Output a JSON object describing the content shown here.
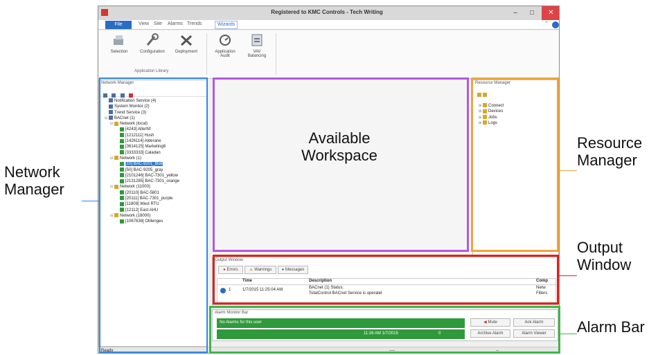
{
  "window": {
    "title": "Registered to KMC Controls - Tech Writing",
    "minimize": "–",
    "maximize": "□",
    "close": "✕"
  },
  "menu": {
    "file": "File",
    "view": "View",
    "site": "Site",
    "alarms": "Alarms",
    "trends": "Trends",
    "wizards": "Wizards",
    "up_arrow": "⌃"
  },
  "ribbon": {
    "buttons": [
      "Selection",
      "Configuration",
      "Deployment",
      "Application Audit",
      "VAV Balancing"
    ],
    "group_label": "Application Library"
  },
  "network_manager": {
    "title": "Network Manager",
    "rows": [
      {
        "text": "Notification Service (4)"
      },
      {
        "text": "System Monitor (2)"
      },
      {
        "text": "Trend Service (3)"
      },
      {
        "text": "BACnet (1)"
      },
      {
        "text": "Network (local)"
      },
      {
        "text": "[4243] AlterNf"
      },
      {
        "text": "[1212111] Hush"
      },
      {
        "text": "[1426114] Alderane"
      },
      {
        "text": "[3614125] Marketing8"
      },
      {
        "text": "[3333333] Caladan"
      },
      {
        "text": "Network (1)"
      },
      {
        "text": "[10] BAC-9201_blue"
      },
      {
        "text": "[50] BAC-9205_gray"
      },
      {
        "text": "[2101246] BAC-7301_yellow"
      },
      {
        "text": "[2131285] BAC-7301_orange"
      },
      {
        "text": "Network (11000)"
      },
      {
        "text": "[20110] BAC-5801"
      },
      {
        "text": "[20111] BAC-7301_purple"
      },
      {
        "text": "[11809] West RTU"
      },
      {
        "text": "[12112] East AHU"
      },
      {
        "text": "Network (18000)"
      },
      {
        "text": "[1067638] OMenges"
      }
    ],
    "status": "Ready"
  },
  "resource_manager": {
    "title": "Resource Manager",
    "items": [
      "Connect",
      "Devices",
      "Jobs",
      "Logs"
    ]
  },
  "output_window": {
    "title": "Output Window",
    "tabs": [
      "Errors",
      "Warnings",
      "Messages"
    ],
    "columns": [
      "Time",
      "Description",
      "Comp"
    ],
    "row": {
      "num": "1",
      "time": "1/7/2015 11:25:04 AM",
      "desc_line1": "BACnet (1) Status:",
      "desc_line2": "TotalControl BACnet Service is operatel",
      "comp_line1": "Netw",
      "comp_line2": "Filters"
    }
  },
  "alarm_bar": {
    "title": "Alarm Monitor Bar",
    "message": "No Alarms for this user",
    "time": "11:26 AM 1/7/2015",
    "count": "0",
    "buttons": [
      "Mute",
      "Ack Alarm",
      "Archive Alarm",
      "Alarm Viewer"
    ]
  },
  "annotations": {
    "workspace": "Available Workspace",
    "network_manager": "Network Manager",
    "resource_manager": "Resource Manager",
    "output_window": "Output Window",
    "alarm_bar": "Alarm Bar"
  },
  "statusbar": {
    "ready": "Ready",
    "dots1": "----",
    "dots2": "--"
  },
  "colors": {
    "network_box": "#2e88e8",
    "workspace_box": "#b25ad9",
    "resource_box": "#f0a43a",
    "output_box": "#e0221c",
    "alarm_box": "#3fb54a",
    "alarm_green": "#2f9a3c"
  }
}
